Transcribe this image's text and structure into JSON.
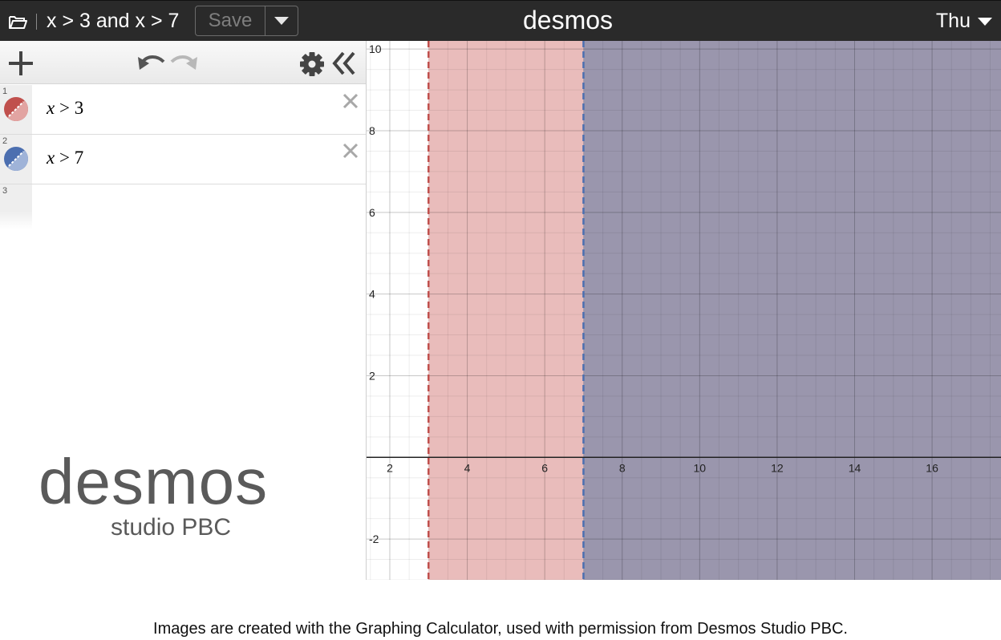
{
  "header": {
    "graph_title": "x > 3 and x > 7",
    "save_label": "Save",
    "brand": "desmos",
    "user_name": "Thu"
  },
  "expressions": [
    {
      "index": "1",
      "variable": "x",
      "operator": ">",
      "value": "3",
      "color": "#c0504d"
    },
    {
      "index": "2",
      "variable": "x",
      "operator": ">",
      "value": "7",
      "color": "#4c6fb0"
    },
    {
      "index": "3"
    }
  ],
  "logo": {
    "word": "desmos",
    "sub": "studio PBC"
  },
  "graph": {
    "x_range": [
      1.4,
      17.8
    ],
    "y_range": [
      -3,
      10.2
    ],
    "x_ticks": [
      "2",
      "4",
      "6",
      "8",
      "10",
      "12",
      "14",
      "16"
    ],
    "y_ticks": [
      "10",
      "8",
      "6",
      "4",
      "2",
      "-2"
    ],
    "regions": [
      {
        "boundary_x": 3,
        "color": "#c0504d",
        "fill": "#e9bcbb",
        "boundary": "dashed"
      },
      {
        "boundary_x": 7,
        "color": "#4c6fb0",
        "fill": "#9a96ad",
        "boundary": "dashed"
      }
    ]
  },
  "caption": "Images are created with the Graphing Calculator, used with permission from Desmos Studio PBC."
}
